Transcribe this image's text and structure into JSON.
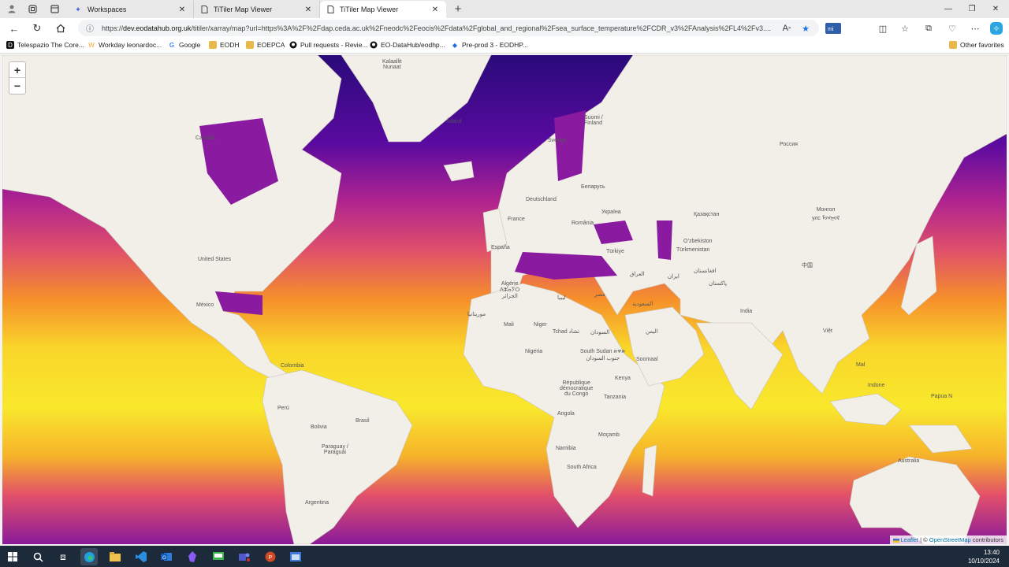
{
  "tabs": [
    {
      "label": "Workspaces",
      "icon": "workspaces-icon"
    },
    {
      "label": "TiTiler Map Viewer",
      "icon": "page-icon"
    },
    {
      "label": "TiTiler Map Viewer",
      "icon": "page-icon",
      "active": true
    }
  ],
  "address": {
    "scheme": "https://",
    "host": "dev.eodatahub.org.uk",
    "path": "/titiler/xarray/map?url=https%3A%2F%2Fdap.ceda.ac.uk%2Fneodc%2Feocis%2Fdata%2Fglobal_and_regional%2Fsea_surface_temperature%2FCDR_v3%2FAnalysis%2FL4%2Fv3...."
  },
  "bookmarks": [
    "Telespazio The Core...",
    "Workday leonardoc...",
    "Google",
    "EODH",
    "EOEPCA",
    "Pull requests - Revie...",
    "EO-DataHub/eodhp...",
    "Pre-prod 3 - EODHP..."
  ],
  "other_favorites": "Other favorites",
  "map": {
    "zoom_in": "+",
    "zoom_out": "−",
    "labels": {
      "kalaallit": "Kalaallit\nNunaat",
      "canada": "Canada",
      "usa": "United States",
      "mexico": "México",
      "colombia": "Colombia",
      "peru": "Perú",
      "bolivia": "Bolivia",
      "brasil": "Brasil",
      "paraguay": "Paraguay /\nParaguái",
      "argentina": "Argentina",
      "island": "Ísland",
      "sverige": "Sverige",
      "suomi": "Suomi /\nFinland",
      "deutschland": "Deutschland",
      "france": "France",
      "espana": "España",
      "belarus": "Беларусь",
      "ukraina": "Україна",
      "romania": "România",
      "turkiye": "Türkiye",
      "rossiya": "Россия",
      "kazakhstan": "Қазақстан",
      "uzbekistan": "O‘zbekiston",
      "turkmenistan": "Türkmenistan",
      "mongol": "Монгол\nулс ᠮᠣᠩᠭᠣᠯ",
      "china": "中国",
      "afghanistan": "افغانستان",
      "pakistan": "پاکستان",
      "iran": "ایران",
      "iraq": "العراق",
      "saudi": "السعودية",
      "yemen": "اليمن",
      "india": "India",
      "algerie": "Algérie\nⴷⵣⴰⵢⵔ\nالجزائر",
      "libya": "ليبيا",
      "misr": "مصر",
      "mauritania": "موريتانيا",
      "mali": "Mali",
      "niger": "Niger",
      "tchad": "Tchad تشاد",
      "sudan": "السودان",
      "nigeria": "Nigeria",
      "south_sudan": "South Sudan ጵዋጵ\nجنوب السودان",
      "somalia": "Soomaal",
      "drc": "République\ndémocratique\ndu Congo",
      "kenya": "Kenya",
      "tanzania": "Tanzania",
      "angola": "Angola",
      "namibia": "Namibia",
      "mocambique": "Moçamb",
      "south_africa": "South Africa",
      "viet": "Việt",
      "malaysia": "Mal",
      "indonesia": "Indone",
      "papua": "Papua N",
      "australia": "Australia"
    },
    "attribution_leaflet": "Leaflet",
    "attribution_sep": " | © ",
    "attribution_osm": "OpenStreetMap",
    "attribution_tail": " contributors"
  },
  "clock": {
    "time": "13:40",
    "date": "10/10/2024"
  },
  "colors": {
    "sst_cold": "#3b0a8c",
    "sst_mid": "#d23b8a",
    "sst_warm": "#f7a51c",
    "sst_hot": "#f9e62a",
    "land": "#f2efe9"
  }
}
